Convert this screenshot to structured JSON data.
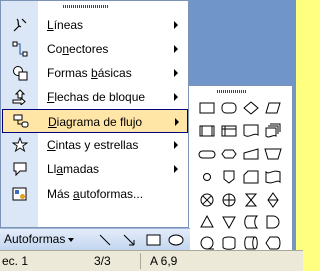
{
  "menu": {
    "items": [
      {
        "pre": "",
        "acc": "L",
        "post": "íneas",
        "icon": "lines-icon",
        "submenu": true
      },
      {
        "pre": "Co",
        "acc": "n",
        "post": "ectores",
        "icon": "connectors-icon",
        "submenu": true
      },
      {
        "pre": "Formas ",
        "acc": "b",
        "post": "ásicas",
        "icon": "basic-shapes-icon",
        "submenu": true
      },
      {
        "pre": "",
        "acc": "F",
        "post": "lechas de bloque",
        "icon": "block-arrows-icon",
        "submenu": true
      },
      {
        "pre": "",
        "acc": "D",
        "post": "iagrama de flujo",
        "icon": "flowchart-icon",
        "submenu": true
      },
      {
        "pre": "",
        "acc": "C",
        "post": "intas y estrellas",
        "icon": "stars-banners-icon",
        "submenu": true
      },
      {
        "pre": "Ll",
        "acc": "a",
        "post": "madas",
        "icon": "callouts-icon",
        "submenu": true
      },
      {
        "pre": "Más ",
        "acc": "a",
        "post": "utoformas...",
        "icon": "more-autoshapes-icon",
        "submenu": false
      }
    ],
    "selected_index": 4
  },
  "toolbar": {
    "autoformas": "Autoformas"
  },
  "status": {
    "section": "ec. 1",
    "pages": "3/3",
    "position": "A 6,9"
  },
  "colors": {
    "highlight": "#ffe6a6",
    "gutter": "#dbe6f7",
    "desktop": "#6f95c9"
  }
}
